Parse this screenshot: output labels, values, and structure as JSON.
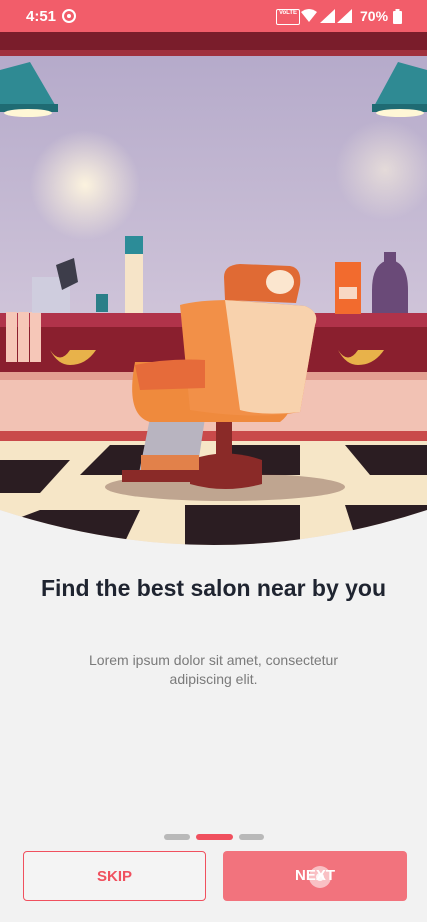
{
  "status_bar": {
    "time": "4:51",
    "volte_label": "VoLTE",
    "battery": "70%",
    "bg_color": "#f25d6a"
  },
  "onboarding": {
    "title": "Find the best salon near by you",
    "subtitle": "Lorem ipsum dolor sit amet, consectetur adipiscing elit.",
    "page_count": 3,
    "active_page": 2
  },
  "actions": {
    "skip_label": "SKIP",
    "next_label": "NEXT"
  },
  "colors": {
    "accent": "#f0505e",
    "next_button": "#f2737d"
  },
  "icons": [
    "target-icon",
    "wifi-icon",
    "signal-icon",
    "battery-icon"
  ]
}
